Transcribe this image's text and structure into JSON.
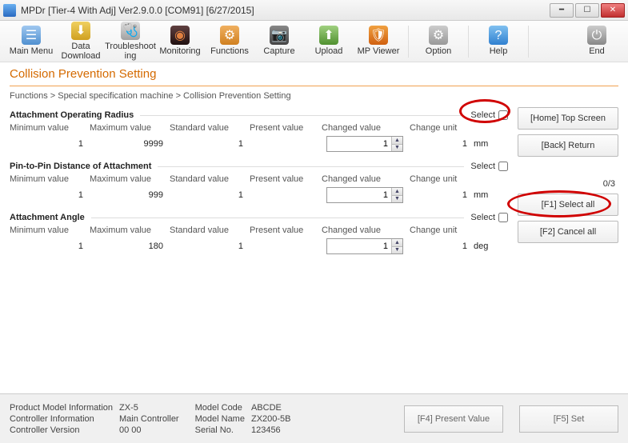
{
  "window": {
    "title": "MPDr [Tier-4 With Adj] Ver2.9.0.0 [COM91] [6/27/2015]"
  },
  "toolbar": {
    "main_menu": "Main Menu",
    "data_download": "Data Download",
    "troubleshooting": "Troubleshoot ing",
    "monitoring": "Monitoring",
    "functions": "Functions",
    "capture": "Capture",
    "upload": "Upload",
    "mp_viewer": "MP Viewer",
    "option": "Option",
    "help": "Help",
    "end": "End"
  },
  "page_title": "Collision Prevention Setting",
  "breadcrumb": "Functions   >   Special specification machine   >   Collision Prevention Setting",
  "labels": {
    "select": "Select",
    "min": "Minimum value",
    "max": "Maximum value",
    "std": "Standard value",
    "present": "Present value",
    "changed": "Changed value",
    "unit": "Change unit"
  },
  "sections": [
    {
      "title": "Attachment Operating Radius",
      "min": "1",
      "max": "9999",
      "std": "1",
      "present": "",
      "changed": "1",
      "change_unit": "1",
      "unit": "mm"
    },
    {
      "title": "Pin-to-Pin Distance of Attachment",
      "min": "1",
      "max": "999",
      "std": "1",
      "present": "",
      "changed": "1",
      "change_unit": "1",
      "unit": "mm"
    },
    {
      "title": "Attachment Angle",
      "min": "1",
      "max": "180",
      "std": "1",
      "present": "",
      "changed": "1",
      "change_unit": "1",
      "unit": "deg"
    }
  ],
  "side": {
    "home": "[Home] Top Screen",
    "back": "[Back] Return",
    "counter": "0/3",
    "select_all": "[F1] Select all",
    "cancel_all": "[F2] Cancel all"
  },
  "footer": {
    "pmi_label": "Product Model Information",
    "pmi_value": "ZX-5",
    "ci_label": "Controller Information",
    "ci_value": "Main Controller",
    "cv_label": "Controller Version",
    "cv_value": "00 00",
    "mc_label": "Model Code",
    "mc_value": "ABCDE",
    "mn_label": "Model Name",
    "mn_value": "ZX200-5B",
    "sn_label": "Serial No.",
    "sn_value": "123456",
    "f4": "[F4] Present Value",
    "f5": "[F5] Set"
  }
}
